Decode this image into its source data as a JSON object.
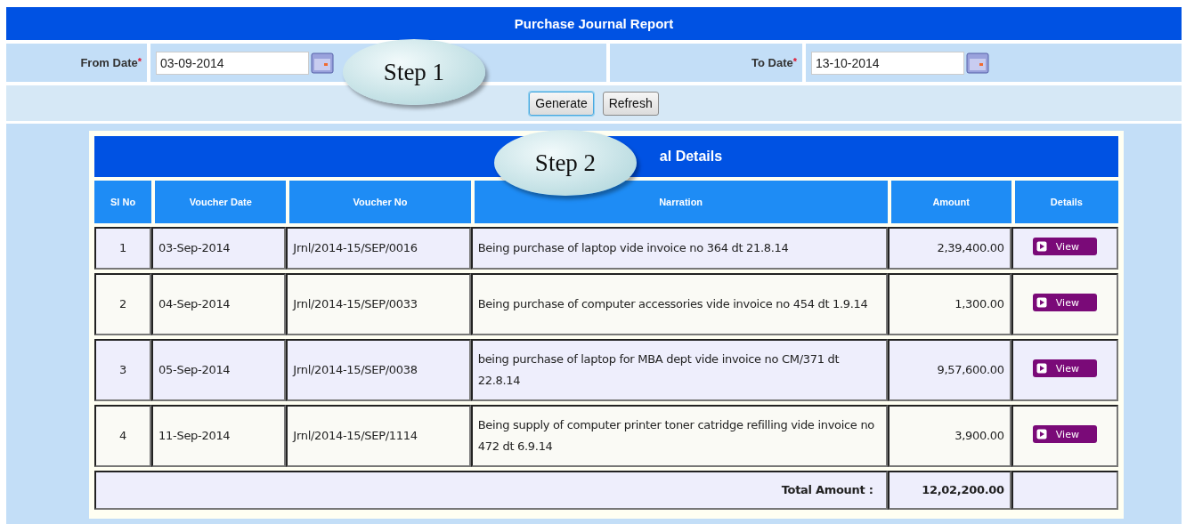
{
  "header": {
    "title": "Purchase Journal Report"
  },
  "filters": [
    {
      "label": "From Date",
      "required_mark": "*",
      "value": "03-09-2014"
    },
    {
      "label": "To Date",
      "required_mark": "*",
      "value": "13-10-2014"
    }
  ],
  "buttons": [
    {
      "label": "Generate",
      "focused": true
    },
    {
      "label": "Refresh",
      "focused": false
    }
  ],
  "callouts": [
    {
      "label": "Step 1"
    },
    {
      "label": "Step 2"
    }
  ],
  "table": {
    "title": "al Details",
    "columns": [
      "Sl No",
      "Voucher Date",
      "Voucher No",
      "Narration",
      "Amount",
      "Details"
    ],
    "rows": [
      {
        "sl_no": "1",
        "voucher_date": "03-Sep-2014",
        "voucher_no": "Jrnl/2014-15/SEP/0016",
        "narration": "Being purchase of laptop vide invoice no 364 dt 21.8.14",
        "amount": "2,39,400.00",
        "details": "View"
      },
      {
        "sl_no": "2",
        "voucher_date": "04-Sep-2014",
        "voucher_no": "Jrnl/2014-15/SEP/0033",
        "narration": "Being purchase of computer accessories vide invoice no 454 dt 1.9.14",
        "amount": "1,300.00",
        "details": "View"
      },
      {
        "sl_no": "3",
        "voucher_date": "05-Sep-2014",
        "voucher_no": "Jrnl/2014-15/SEP/0038",
        "narration": "being purchase of laptop for MBA dept vide invoice no CM/371 dt 22.8.14",
        "amount": "9,57,600.00",
        "details": "View"
      },
      {
        "sl_no": "4",
        "voucher_date": "11-Sep-2014",
        "voucher_no": "Jrnl/2014-15/SEP/1114",
        "narration": "Being supply of computer printer toner catridge refilling vide invoice no 472 dt 6.9.14",
        "amount": "3,900.00",
        "details": "View"
      }
    ],
    "total": {
      "label": "Total Amount  :",
      "value": "12,02,200.00"
    }
  }
}
